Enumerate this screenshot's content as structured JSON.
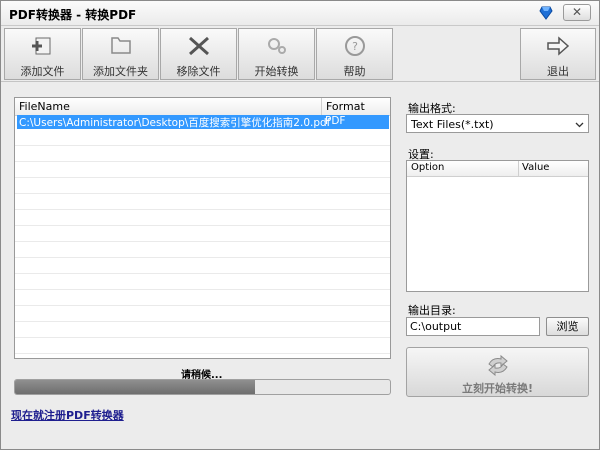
{
  "window": {
    "title": "PDF转换器 - 转换PDF",
    "close_symbol": "✕"
  },
  "toolbar": {
    "buttons": [
      {
        "label": "添加文件",
        "icon": "add-file-icon"
      },
      {
        "label": "添加文件夹",
        "icon": "add-folder-icon"
      },
      {
        "label": "移除文件",
        "icon": "remove-file-icon"
      },
      {
        "label": "开始转换",
        "icon": "start-convert-icon"
      },
      {
        "label": "帮助",
        "icon": "help-icon"
      },
      {
        "label": "退出",
        "icon": "exit-icon"
      }
    ]
  },
  "file_list": {
    "columns": [
      "FileName",
      "Format"
    ],
    "rows": [
      {
        "filename": "C:\\Users\\Administrator\\Desktop\\百度搜索引擎优化指南2.0.pdf",
        "format": "PDF"
      }
    ]
  },
  "status": {
    "text": "请稍候...",
    "progress": 0.64
  },
  "register_link": "现在就注册PDF转换器",
  "output": {
    "format_label": "输出格式:",
    "format_value": "Text Files(*.txt)",
    "settings_label": "设置:",
    "settings_columns": [
      "Option",
      "Value"
    ],
    "dir_label": "输出目录:",
    "dir_value": "C:\\output",
    "browse_label": "浏览",
    "convert_label": "立刻开始转换!"
  },
  "colors": {
    "selection": "#3399ff",
    "progress": "#7a7a7a"
  }
}
